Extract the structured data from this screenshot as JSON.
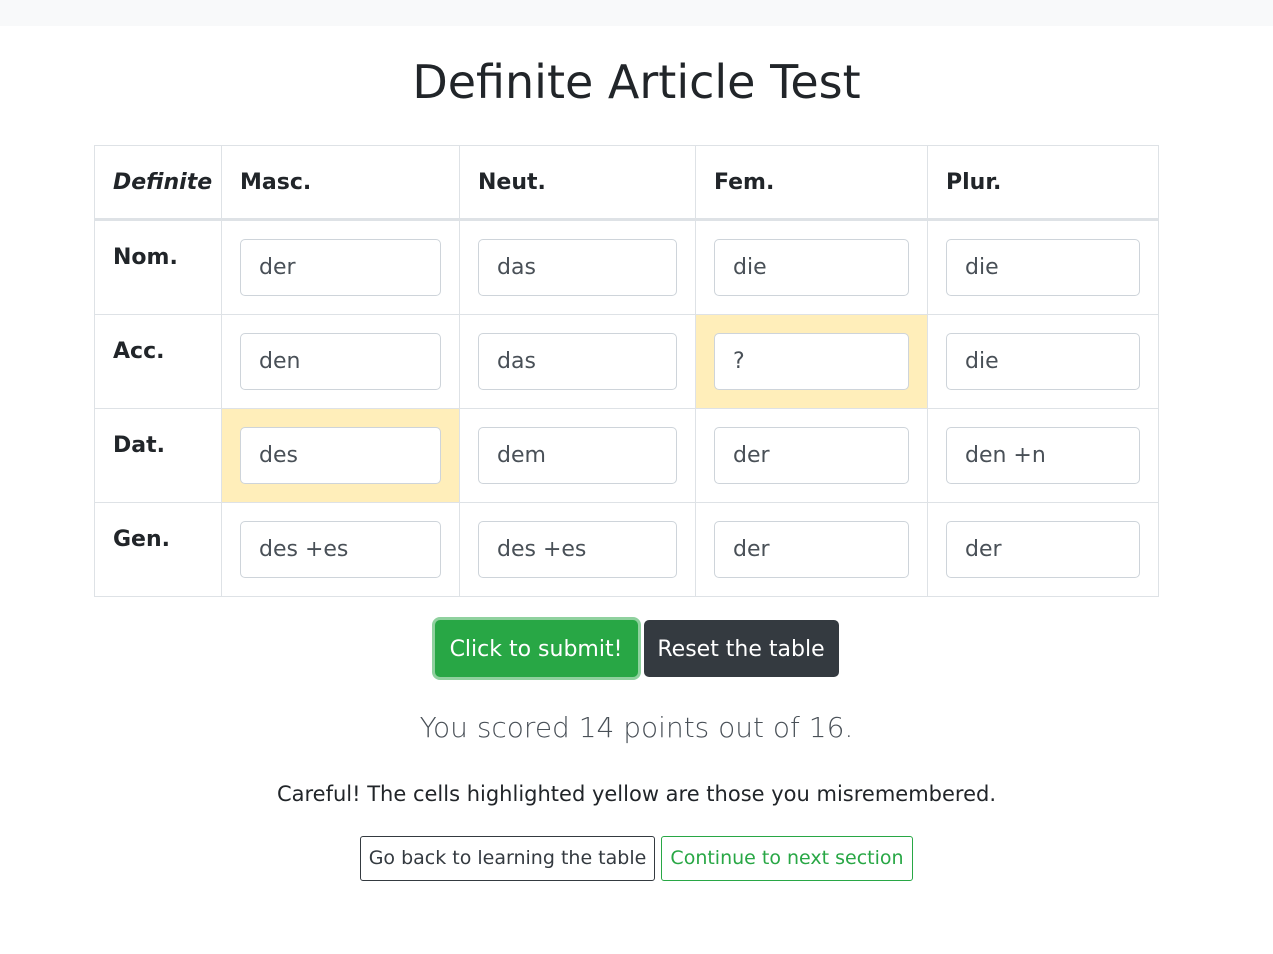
{
  "page": {
    "title": "Definite Article Test"
  },
  "table": {
    "corner": "Definite",
    "columns": [
      "Masc.",
      "Neut.",
      "Fem.",
      "Plur."
    ],
    "rows": [
      {
        "label": "Nom.",
        "cells": [
          "der",
          "das",
          "die",
          "die"
        ]
      },
      {
        "label": "Acc.",
        "cells": [
          "den",
          "das",
          "?",
          "die"
        ]
      },
      {
        "label": "Dat.",
        "cells": [
          "des",
          "dem",
          "der",
          "den +n"
        ]
      },
      {
        "label": "Gen.",
        "cells": [
          "des +es",
          "des +es",
          "der",
          "der"
        ]
      }
    ],
    "highlight_color": "#ffeeba"
  },
  "actions": {
    "submit": "Click to submit!",
    "reset": "Reset the table"
  },
  "result": {
    "score_text": "You scored 14 points out of 16.",
    "warning_text": "Careful! The cells highlighted yellow are those you misremembered."
  },
  "nav": {
    "back": "Go back to learning the table",
    "next": "Continue to next section"
  },
  "colors": {
    "success": "#28a745",
    "dark": "#343a40"
  }
}
